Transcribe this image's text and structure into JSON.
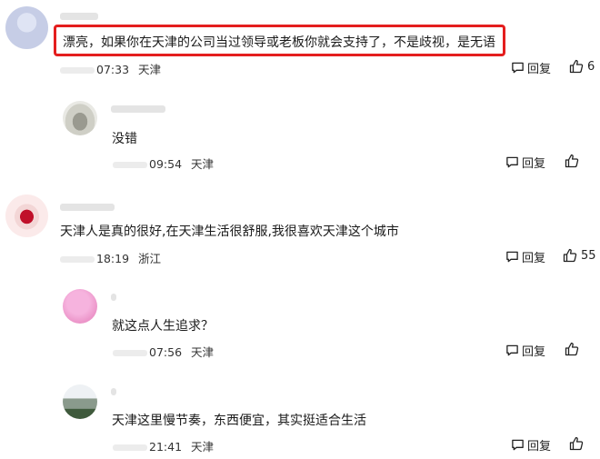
{
  "comments": [
    {
      "text": "漂亮，如果你在天津的公司当过领导或老板你就会支持了，不是歧视，是无语",
      "time": "07:33",
      "location": "天津",
      "reply_label": "回复",
      "likes": "6"
    },
    {
      "text": "没错",
      "time": "09:54",
      "location": "天津",
      "reply_label": "回复",
      "likes": ""
    },
    {
      "text": "天津人是真的很好,在天津生活很舒服,我很喜欢天津这个城市",
      "time": "18:19",
      "location": "浙江",
      "reply_label": "回复",
      "likes": "55"
    },
    {
      "text": "就这点人生追求？",
      "time": "07:56",
      "location": "天津",
      "reply_label": "回复",
      "likes": ""
    },
    {
      "text": "天津这里慢节奏，东西便宜，其实挺适合生活",
      "time": "21:41",
      "location": "天津",
      "reply_label": "回复",
      "likes": ""
    }
  ],
  "icons": {
    "reply": "comment-bubble-icon",
    "like": "thumbs-up-icon"
  },
  "colors": {
    "highlight": "#e41e1e"
  }
}
